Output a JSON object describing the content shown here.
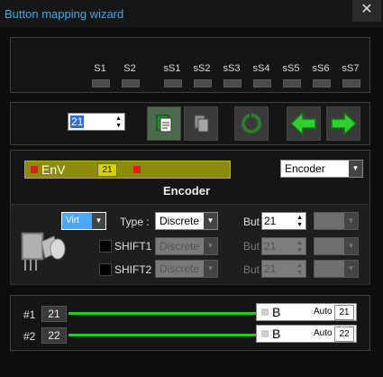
{
  "window": {
    "title": "Button mapping wizard",
    "close_glyph": "✕"
  },
  "slots": [
    "S1",
    "S2",
    "sS1",
    "sS2",
    "sS3",
    "sS4",
    "sS5",
    "sS6",
    "sS7"
  ],
  "toolbar": {
    "number_value": "21",
    "buttons": [
      {
        "name": "paste-button",
        "icon": "paste-icon"
      },
      {
        "name": "copy-button",
        "icon": "copy-icon"
      },
      {
        "name": "refresh-button",
        "icon": "refresh-icon"
      },
      {
        "name": "previous-button",
        "icon": "arrow-left-icon"
      },
      {
        "name": "next-button",
        "icon": "arrow-right-icon"
      }
    ]
  },
  "encoder": {
    "bar_label": "EnV",
    "bar_value": "21",
    "type_select": "Encoder",
    "heading": "Encoder",
    "virt_select": "Virt",
    "bar_color": "#8b8b05"
  },
  "rows": [
    {
      "label": "Type :",
      "type": "Discrete",
      "but_label": "But",
      "but_value": "21",
      "enabled": true
    },
    {
      "label": "SHIFT1",
      "type": "Discrete",
      "but_label": "But",
      "but_value": "21",
      "enabled": false
    },
    {
      "label": "SHIFT2",
      "type": "Discrete",
      "but_label": "But",
      "but_value": "21",
      "enabled": false
    }
  ],
  "mappings": [
    {
      "index": "#1",
      "value": "21",
      "letter": "B",
      "mode": "Auto",
      "code": "21"
    },
    {
      "index": "#2",
      "value": "22",
      "letter": "B",
      "mode": "Auto",
      "code": "22"
    }
  ]
}
